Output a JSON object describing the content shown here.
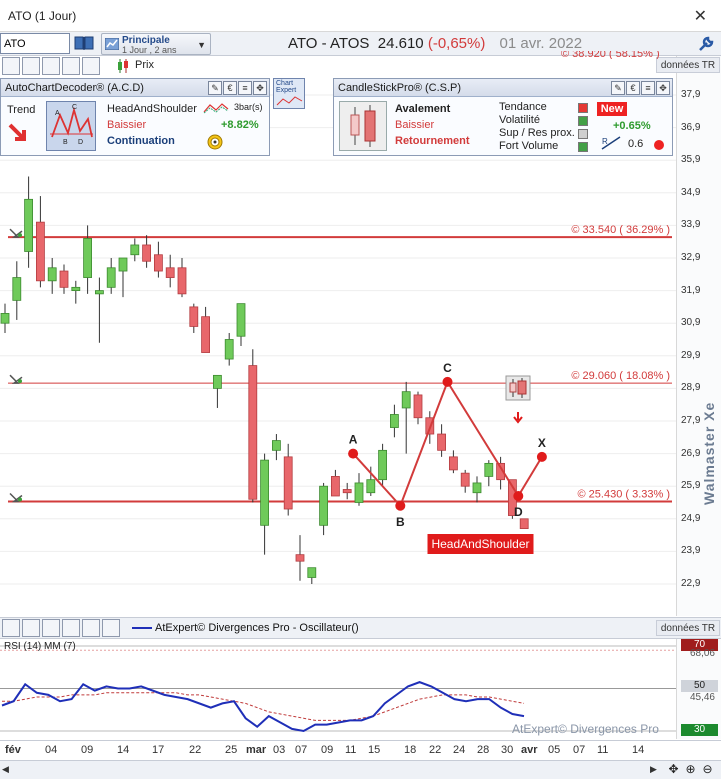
{
  "window": {
    "title": "ATO (1 Jour)",
    "close": "✕"
  },
  "toolbar": {
    "ticker": "ATO",
    "period_line1": "Principale",
    "period_line2": "1 Jour , 2 ans",
    "heading_symbol": "ATO - ATOS",
    "heading_price": "24.610",
    "heading_change": "(-0,65%)",
    "heading_date": "01 avr. 2022",
    "prix_label": "Prix"
  },
  "acd": {
    "title": "AutoChartDecoder® (A.C.D)",
    "trend_label": "Trend",
    "pattern_name": "HeadAndShoulder",
    "direction": "Baissier",
    "kind": "Continuation",
    "bars": "3bar(s)",
    "gain": "+8.82%",
    "diagram_letters": [
      "A",
      "C",
      "B",
      "D"
    ]
  },
  "chart_expert": {
    "label": "Chart Expert"
  },
  "csp": {
    "title": "CandleStickPro® (C.S.P)",
    "pattern_name": "Avalement",
    "direction": "Baissier",
    "kind": "Retournement",
    "criteria": [
      {
        "label": "Tendance",
        "color": "#e53935"
      },
      {
        "label": "Volatilité",
        "color": "#43a047"
      },
      {
        "label": "Sup / Res prox.",
        "color": "#cfcfcf"
      },
      {
        "label": "Fort Volume",
        "color": "#43a047"
      }
    ],
    "new_label": "New",
    "gain": "+0.65%",
    "value": "0.6"
  },
  "price_axis": {
    "labels": [
      "37,9",
      "36,9",
      "35,9",
      "34,9",
      "33,9",
      "32,9",
      "31,9",
      "30,9",
      "29,9",
      "28,9",
      "27,9",
      "26,9",
      "25,9",
      "24,9",
      "23,9",
      "22,9"
    ],
    "top_clipped": "© 38.920 ( 58.15% )",
    "donnees": "données TR",
    "watermark": "Walmaster Xe"
  },
  "levels": [
    {
      "price": 33.54,
      "label": "© 33.540 ( 36.29% )",
      "thick": true
    },
    {
      "price": 29.06,
      "label": "© 29.060 ( 18.08% )",
      "thick": false
    },
    {
      "price": 25.43,
      "label": "© 25.430 ( 3.33% )",
      "thick": true
    }
  ],
  "pattern": {
    "name": "HeadAndShoulder",
    "points": [
      {
        "label": "A",
        "x_index": 15,
        "price": 26.9
      },
      {
        "label": "B",
        "x_index": 17,
        "price": 25.3
      },
      {
        "label": "C",
        "x_index": 19,
        "price": 29.1
      },
      {
        "label": "D",
        "x_index": 22,
        "price": 25.6
      },
      {
        "label": "X",
        "x_index": 23,
        "price": 26.8
      }
    ]
  },
  "chart_data": {
    "type": "candlestick",
    "ylim": [
      22.0,
      38.4
    ],
    "series": [
      {
        "o": 30.9,
        "h": 31.5,
        "l": 30.6,
        "c": 31.2
      },
      {
        "o": 31.6,
        "h": 32.8,
        "l": 31.0,
        "c": 32.3
      },
      {
        "o": 33.1,
        "h": 35.4,
        "l": 32.6,
        "c": 34.7
      },
      {
        "o": 34.0,
        "h": 34.8,
        "l": 32.0,
        "c": 32.2
      },
      {
        "o": 32.2,
        "h": 32.9,
        "l": 31.8,
        "c": 32.6
      },
      {
        "o": 32.5,
        "h": 32.7,
        "l": 31.8,
        "c": 32.0
      },
      {
        "o": 31.9,
        "h": 32.2,
        "l": 31.5,
        "c": 32.0
      },
      {
        "o": 32.3,
        "h": 33.9,
        "l": 31.8,
        "c": 33.5
      },
      {
        "o": 31.8,
        "h": 32.3,
        "l": 30.3,
        "c": 31.9
      },
      {
        "o": 32.0,
        "h": 32.9,
        "l": 31.8,
        "c": 32.6
      },
      {
        "o": 32.5,
        "h": 32.9,
        "l": 31.7,
        "c": 32.9
      },
      {
        "o": 33.0,
        "h": 33.5,
        "l": 32.8,
        "c": 33.3
      },
      {
        "o": 33.3,
        "h": 33.6,
        "l": 32.6,
        "c": 32.8
      },
      {
        "o": 33.0,
        "h": 33.4,
        "l": 32.3,
        "c": 32.5
      },
      {
        "o": 32.6,
        "h": 33.0,
        "l": 32.0,
        "c": 32.3
      },
      {
        "o": 32.6,
        "h": 32.9,
        "l": 31.7,
        "c": 31.8
      },
      {
        "o": 31.4,
        "h": 31.5,
        "l": 30.6,
        "c": 30.8
      },
      {
        "o": 31.1,
        "h": 31.4,
        "l": 30.0,
        "c": 30.0
      },
      {
        "o": 28.9,
        "h": 29.2,
        "l": 28.3,
        "c": 29.3
      },
      {
        "o": 29.8,
        "h": 30.6,
        "l": 29.6,
        "c": 30.4
      },
      {
        "o": 30.5,
        "h": 31.5,
        "l": 30.2,
        "c": 31.5
      },
      {
        "o": 29.6,
        "h": 30.1,
        "l": 25.4,
        "c": 25.5
      },
      {
        "o": 24.7,
        "h": 26.9,
        "l": 23.8,
        "c": 26.7
      },
      {
        "o": 27.0,
        "h": 27.5,
        "l": 26.7,
        "c": 27.3
      },
      {
        "o": 26.8,
        "h": 27.2,
        "l": 25.0,
        "c": 25.2
      },
      {
        "o": 23.8,
        "h": 24.4,
        "l": 23.0,
        "c": 23.6
      },
      {
        "o": 23.1,
        "h": 23.3,
        "l": 22.9,
        "c": 23.4
      },
      {
        "o": 24.7,
        "h": 26.0,
        "l": 24.4,
        "c": 25.9
      },
      {
        "o": 26.2,
        "h": 26.4,
        "l": 25.6,
        "c": 25.6
      },
      {
        "o": 25.8,
        "h": 26.0,
        "l": 25.5,
        "c": 25.7
      },
      {
        "o": 25.4,
        "h": 26.3,
        "l": 25.3,
        "c": 26.0
      },
      {
        "o": 25.7,
        "h": 26.5,
        "l": 25.6,
        "c": 26.1
      },
      {
        "o": 26.1,
        "h": 27.2,
        "l": 25.9,
        "c": 27.0
      },
      {
        "o": 27.7,
        "h": 28.4,
        "l": 27.4,
        "c": 28.1
      },
      {
        "o": 28.3,
        "h": 29.1,
        "l": 26.9,
        "c": 28.8
      },
      {
        "o": 28.7,
        "h": 28.8,
        "l": 27.8,
        "c": 28.0
      },
      {
        "o": 28.0,
        "h": 28.2,
        "l": 27.2,
        "c": 27.5
      },
      {
        "o": 27.5,
        "h": 27.8,
        "l": 26.8,
        "c": 27.0
      },
      {
        "o": 26.8,
        "h": 27.0,
        "l": 26.3,
        "c": 26.4
      },
      {
        "o": 26.3,
        "h": 26.4,
        "l": 25.7,
        "c": 25.9
      },
      {
        "o": 25.7,
        "h": 26.2,
        "l": 25.4,
        "c": 26.0
      },
      {
        "o": 26.2,
        "h": 26.7,
        "l": 25.9,
        "c": 26.6
      },
      {
        "o": 26.6,
        "h": 26.8,
        "l": 25.8,
        "c": 26.1
      },
      {
        "o": 26.1,
        "h": 26.1,
        "l": 24.9,
        "c": 25.0
      },
      {
        "o": 24.9,
        "h": 24.9,
        "l": 24.6,
        "c": 24.6
      }
    ]
  },
  "oscillator": {
    "title": "AtExpert© Divergences Pro - Oscillateur()",
    "donnees": "données TR",
    "rsi_label": "RSI (14) MM (7)",
    "levels": [
      "70",
      "50",
      "30"
    ],
    "axis_labels": [
      "68,06",
      "45,46"
    ],
    "watermark": "AtExpert© Divergences Pro",
    "rsi": [
      42,
      44,
      52,
      48,
      47,
      44,
      45,
      52,
      49,
      51,
      50,
      50,
      51,
      49,
      47,
      46,
      45,
      43,
      41,
      43,
      44,
      36,
      32,
      37,
      34,
      31,
      30,
      33,
      33,
      34,
      35,
      35,
      37,
      43,
      47,
      51,
      53,
      51,
      48,
      45,
      44,
      45,
      45,
      41,
      38,
      37
    ],
    "ma": [
      44,
      44,
      45,
      46,
      46,
      46,
      47,
      47,
      47,
      48,
      48,
      48,
      48,
      48,
      48,
      48,
      47,
      47,
      46,
      45,
      44,
      43,
      41,
      39,
      38,
      37,
      36,
      35,
      35,
      35,
      35,
      36,
      37,
      39,
      41,
      43,
      45,
      46,
      47,
      47,
      47,
      46,
      46,
      45,
      44,
      43
    ]
  },
  "date_axis": {
    "labels": [
      {
        "t": "fév",
        "b": true
      },
      {
        "t": "04",
        "b": false
      },
      {
        "t": "09",
        "b": false
      },
      {
        "t": "14",
        "b": false
      },
      {
        "t": "17",
        "b": false
      },
      {
        "t": "22",
        "b": false
      },
      {
        "t": "25",
        "b": false
      },
      {
        "t": "mar",
        "b": true
      },
      {
        "t": "03",
        "b": false
      },
      {
        "t": "07",
        "b": false
      },
      {
        "t": "09",
        "b": false
      },
      {
        "t": "11",
        "b": false
      },
      {
        "t": "15",
        "b": false
      },
      {
        "t": "18",
        "b": false
      },
      {
        "t": "22",
        "b": false
      },
      {
        "t": "24",
        "b": false
      },
      {
        "t": "28",
        "b": false
      },
      {
        "t": "30",
        "b": false
      },
      {
        "t": "avr",
        "b": true
      },
      {
        "t": "05",
        "b": false
      },
      {
        "t": "07",
        "b": false
      },
      {
        "t": "11",
        "b": false
      },
      {
        "t": "14",
        "b": false
      }
    ]
  },
  "colors": {
    "up": "#6fca5a",
    "down": "#e8676b",
    "level": "#d23b3b",
    "rsi": "#1f2fb8",
    "ma": "#c03b3b"
  }
}
